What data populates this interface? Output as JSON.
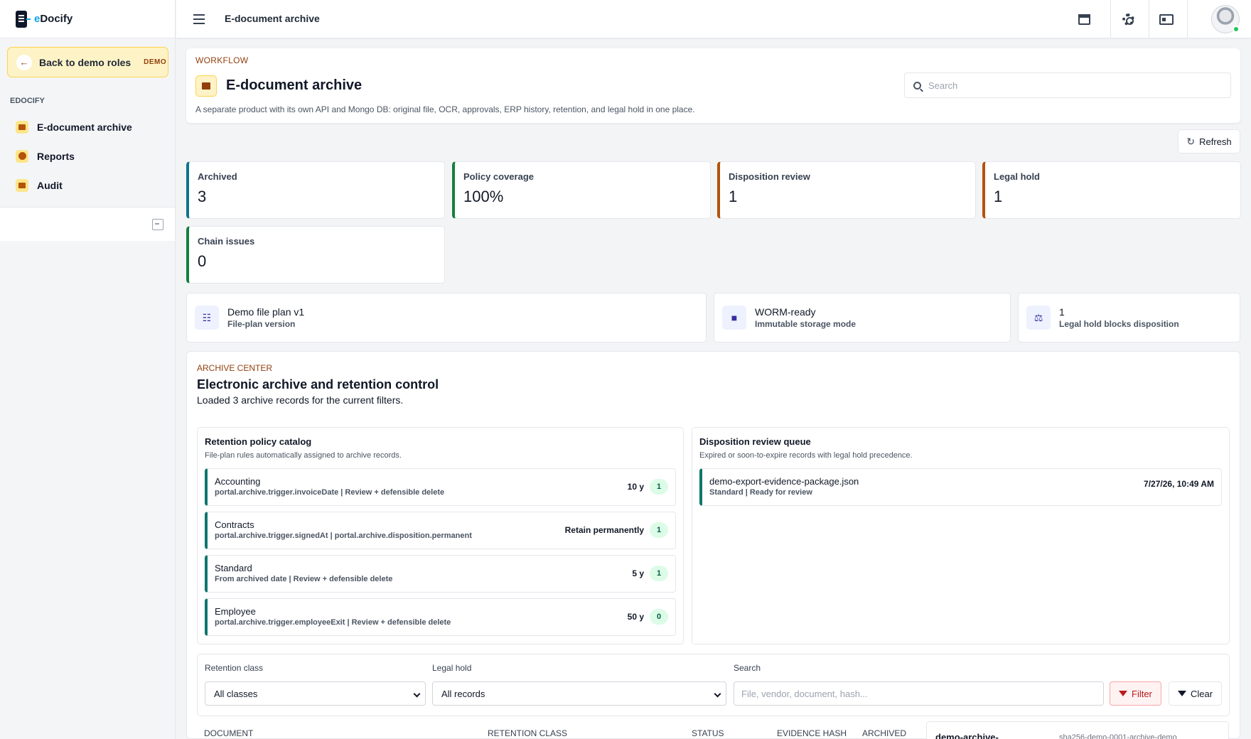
{
  "brand": {
    "name_prefix": "e",
    "name_suffix": "Docify"
  },
  "sidebar": {
    "back_label": "Back to demo roles",
    "demo_badge": "DEMO",
    "section": "EDOCIFY",
    "items": [
      {
        "label": "E-document archive",
        "icon": "archive-icon"
      },
      {
        "label": "Reports",
        "icon": "pie-chart-icon"
      },
      {
        "label": "Audit",
        "icon": "clipboard-icon"
      }
    ]
  },
  "topbar": {
    "title": "E-document archive"
  },
  "header": {
    "eyebrow": "WORKFLOW",
    "title": "E-document archive",
    "subtitle": "A separate product with its own API and Mongo DB: original file, OCR, approvals, ERP history, retention, and legal hold in one place.",
    "search_placeholder": "Search"
  },
  "refresh_label": "Refresh",
  "stats": [
    {
      "label": "Archived",
      "value": "3",
      "color": "#0e7490"
    },
    {
      "label": "Policy coverage",
      "value": "100%",
      "color": "#15803d"
    },
    {
      "label": "Disposition review",
      "value": "1",
      "color": "#b45309"
    },
    {
      "label": "Legal hold",
      "value": "1",
      "color": "#b45309"
    },
    {
      "label": "Chain issues",
      "value": "0",
      "color": "#15803d"
    }
  ],
  "info_cards": [
    {
      "title": "Demo file plan v1",
      "sub": "File-plan version",
      "icon": "sitemap-icon"
    },
    {
      "title": "WORM-ready",
      "sub": "Immutable storage mode",
      "icon": "lock-icon"
    },
    {
      "title": "1",
      "sub": "Legal hold blocks disposition",
      "icon": "scale-icon"
    }
  ],
  "archive_center": {
    "eyebrow": "ARCHIVE CENTER",
    "title": "Electronic archive and retention control",
    "message": "Loaded 3 archive records for the current filters."
  },
  "retention": {
    "title": "Retention policy catalog",
    "subtitle": "File-plan rules automatically assigned to archive records.",
    "rows": [
      {
        "title": "Accounting",
        "sub": "portal.archive.trigger.invoiceDate | Review + defensible delete",
        "period": "10 y",
        "count": "1"
      },
      {
        "title": "Contracts",
        "sub": "portal.archive.trigger.signedAt | portal.archive.disposition.permanent",
        "period": "Retain permanently",
        "count": "1"
      },
      {
        "title": "Standard",
        "sub": "From archived date | Review + defensible delete",
        "period": "5 y",
        "count": "1"
      },
      {
        "title": "Employee",
        "sub": "portal.archive.trigger.employeeExit | Review + defensible delete",
        "period": "50 y",
        "count": "0"
      }
    ]
  },
  "disposition": {
    "title": "Disposition review queue",
    "subtitle": "Expired or soon-to-expire records with legal hold precedence.",
    "rows": [
      {
        "title": "demo-export-evidence-package.json",
        "sub": "Standard | Ready for review",
        "date": "7/27/26, 10:49 AM"
      }
    ]
  },
  "filters": {
    "class_label": "Retention class",
    "class_value": "All classes",
    "hold_label": "Legal hold",
    "hold_value": "All records",
    "search_label": "Search",
    "search_placeholder": "File, vendor, document, hash...",
    "filter_btn": "Filter",
    "clear_btn": "Clear"
  },
  "table_headers": [
    "DOCUMENT",
    "RETENTION CLASS",
    "STATUS",
    "EVIDENCE HASH",
    "ARCHIVED"
  ],
  "preview": {
    "title": "demo-archive-",
    "hash": "sha256-demo-0001-archive-demo"
  }
}
